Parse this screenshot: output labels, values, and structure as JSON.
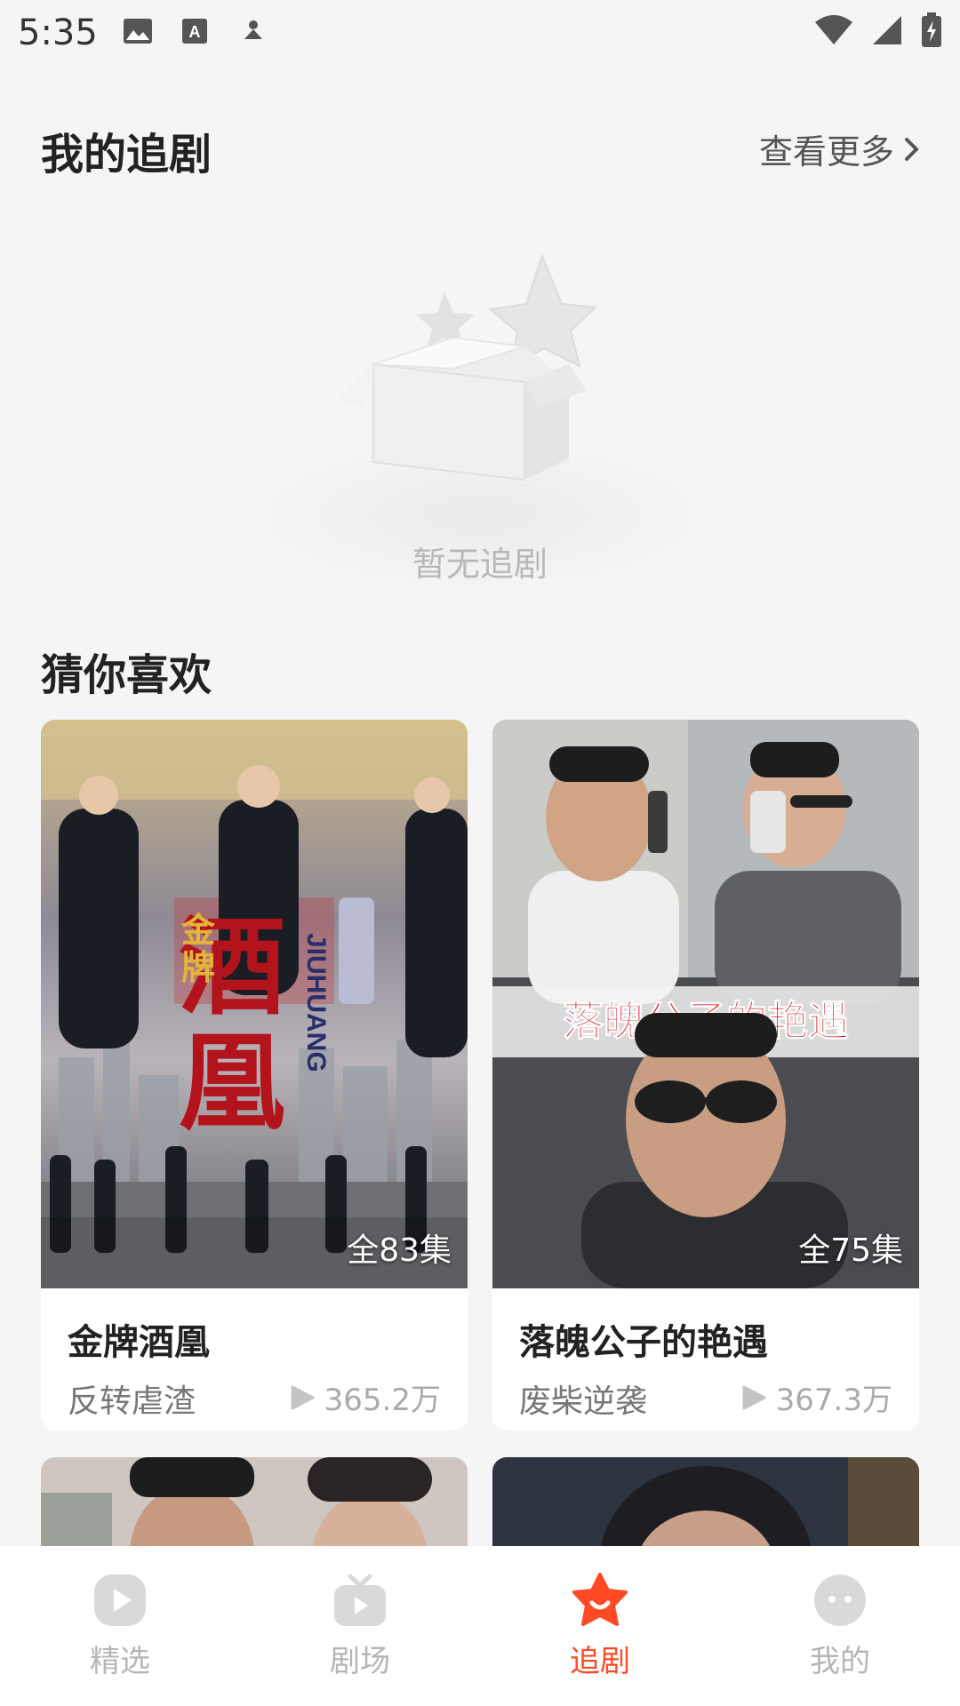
{
  "status_bar": {
    "time": "5:35"
  },
  "my_follow": {
    "title": "我的追剧",
    "see_more": "查看更多",
    "empty_text": "暂无追剧"
  },
  "recommend": {
    "title": "猜你喜欢",
    "cards": [
      {
        "poster_text": "金牌酒凰",
        "poster_sub": "JIUHUANG",
        "episodes": "全83集",
        "title": "金牌酒凰",
        "tag": "反转虐渣",
        "plays": "365.2万"
      },
      {
        "poster_text": "落魄公子的艳遇",
        "episodes": "全75集",
        "title": "落魄公子的艳遇",
        "tag": "废柴逆袭",
        "plays": "367.3万"
      }
    ]
  },
  "bottom_nav": [
    {
      "label": "精选",
      "icon": "play-square-icon",
      "active": false
    },
    {
      "label": "剧场",
      "icon": "tv-icon",
      "active": false
    },
    {
      "label": "追剧",
      "icon": "star-smile-icon",
      "active": true
    },
    {
      "label": "我的",
      "icon": "face-icon",
      "active": false
    }
  ],
  "colors": {
    "accent": "#ff4a24",
    "background": "#f5f5f5"
  }
}
